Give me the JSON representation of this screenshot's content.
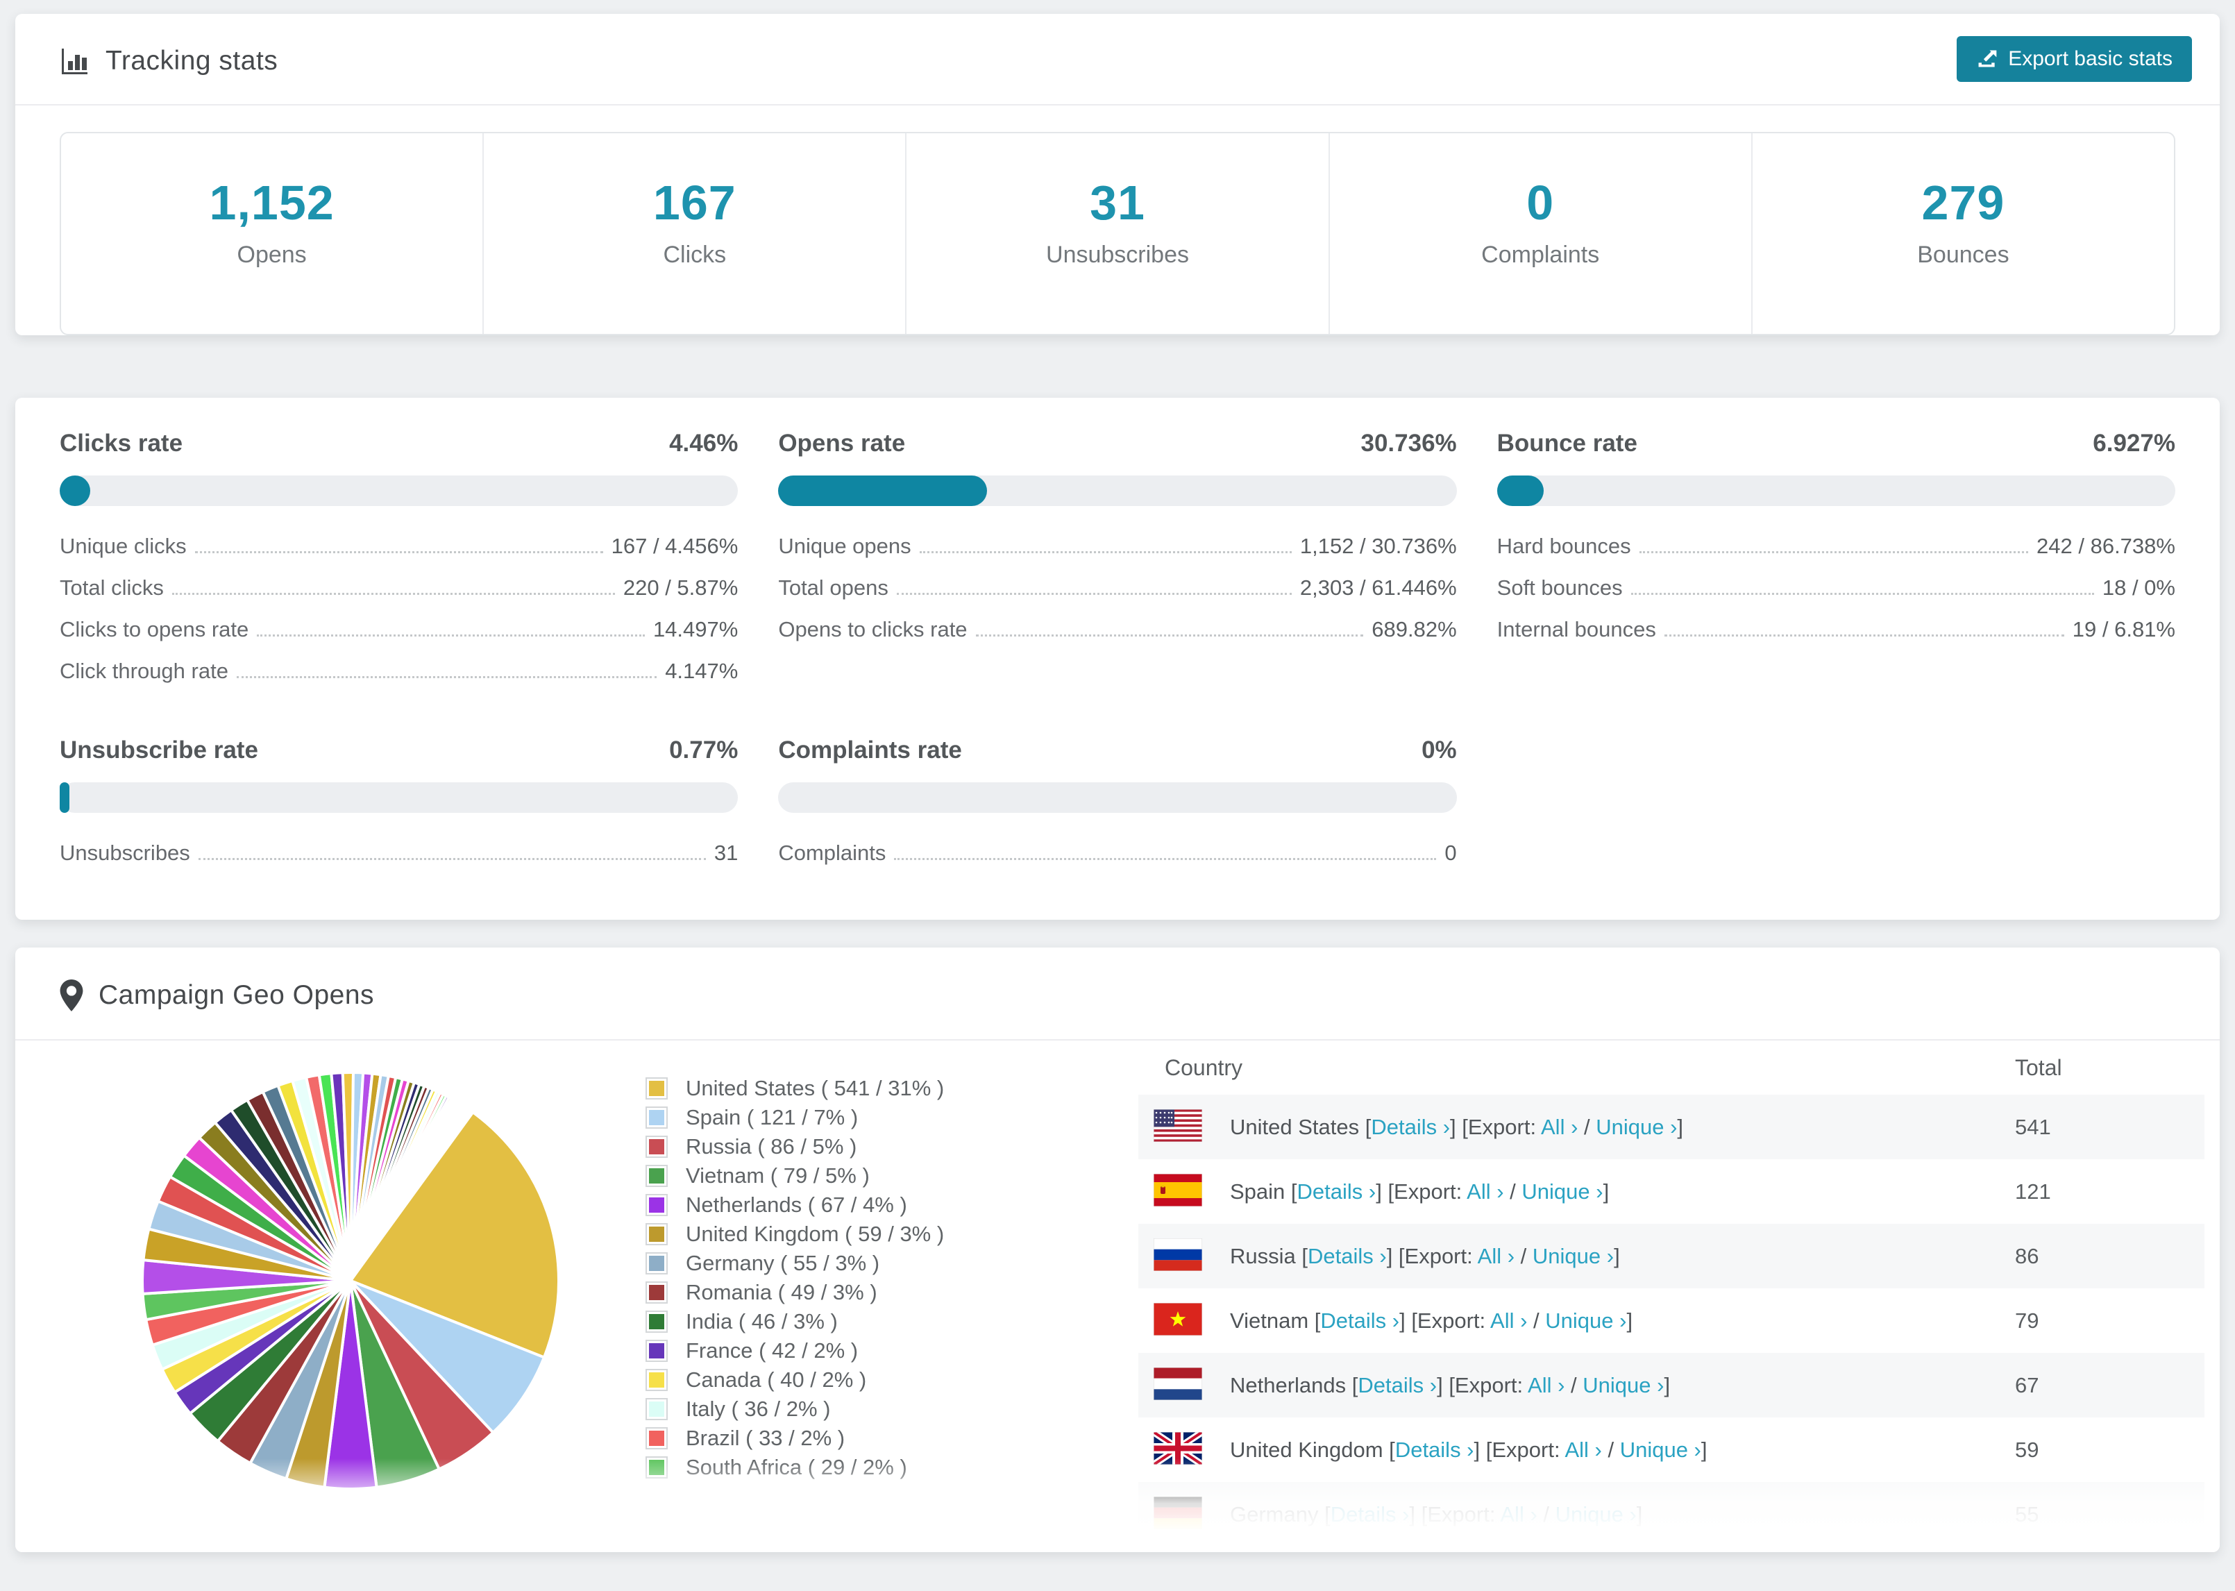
{
  "colors": {
    "accent_teal": "#15829c",
    "bar_fill_teal": "#0f86a2",
    "link_teal": "#2aa2c2",
    "stat_number_teal": "#1e93ae",
    "bar_track": "#eceef1",
    "row_stripe": "#f6f7f8"
  },
  "tracking": {
    "title": "Tracking stats",
    "export_button_label": "Export basic stats",
    "stats": [
      {
        "value": "1,152",
        "label": "Opens"
      },
      {
        "value": "167",
        "label": "Clicks"
      },
      {
        "value": "31",
        "label": "Unsubscribes"
      },
      {
        "value": "0",
        "label": "Complaints"
      },
      {
        "value": "279",
        "label": "Bounces"
      }
    ]
  },
  "rates": [
    {
      "title": "Clicks rate",
      "value": "4.46%",
      "percent": 4.46,
      "rows": [
        {
          "label": "Unique clicks",
          "value": "167 / 4.456%"
        },
        {
          "label": "Total clicks",
          "value": "220 / 5.87%"
        },
        {
          "label": "Clicks to opens rate",
          "value": "14.497%"
        },
        {
          "label": "Click through rate",
          "value": "4.147%"
        }
      ]
    },
    {
      "title": "Opens rate",
      "value": "30.736%",
      "percent": 30.736,
      "rows": [
        {
          "label": "Unique opens",
          "value": "1,152 / 30.736%"
        },
        {
          "label": "Total opens",
          "value": "2,303 / 61.446%"
        },
        {
          "label": "Opens to clicks rate",
          "value": "689.82%"
        }
      ]
    },
    {
      "title": "Bounce rate",
      "value": "6.927%",
      "percent": 6.927,
      "rows": [
        {
          "label": "Hard bounces",
          "value": "242 / 86.738%"
        },
        {
          "label": "Soft bounces",
          "value": "18 / 0%"
        },
        {
          "label": "Internal bounces",
          "value": "19 / 6.81%"
        }
      ]
    },
    {
      "title": "Unsubscribe rate",
      "value": "0.77%",
      "percent": 0.77,
      "rows": [
        {
          "label": "Unsubscribes",
          "value": "31"
        }
      ]
    },
    {
      "title": "Complaints rate",
      "value": "0%",
      "percent": 0,
      "rows": [
        {
          "label": "Complaints",
          "value": "0"
        }
      ]
    }
  ],
  "geo": {
    "title": "Campaign Geo Opens",
    "columns": [
      "Country",
      "Total"
    ],
    "link_labels": {
      "details": "Details",
      "export_prefix": "Export:",
      "all": "All",
      "unique": "Unique"
    },
    "rows": [
      {
        "country": "United States",
        "flag": "us",
        "total": "541"
      },
      {
        "country": "Spain",
        "flag": "es",
        "total": "121"
      },
      {
        "country": "Russia",
        "flag": "ru",
        "total": "86"
      },
      {
        "country": "Vietnam",
        "flag": "vn",
        "total": "79"
      },
      {
        "country": "Netherlands",
        "flag": "nl",
        "total": "67"
      },
      {
        "country": "United Kingdom",
        "flag": "gb",
        "total": "59"
      },
      {
        "country": "Germany",
        "flag": "de",
        "total": "55"
      }
    ]
  },
  "chart_data": {
    "type": "pie",
    "title": "Campaign Geo Opens",
    "legend_position": "right",
    "legend_format": "{label} ( {value} / {percent}% )",
    "slices": [
      {
        "label": "United States",
        "value": 541,
        "percent": 31,
        "color": "#e3bf43"
      },
      {
        "label": "Spain",
        "value": 121,
        "percent": 7,
        "color": "#aed3f2"
      },
      {
        "label": "Russia",
        "value": 86,
        "percent": 5,
        "color": "#c94d54"
      },
      {
        "label": "Vietnam",
        "value": 79,
        "percent": 5,
        "color": "#4aa24e"
      },
      {
        "label": "Netherlands",
        "value": 67,
        "percent": 4,
        "color": "#9b33e6"
      },
      {
        "label": "United Kingdom",
        "value": 59,
        "percent": 3,
        "color": "#bd9a2d"
      },
      {
        "label": "Germany",
        "value": 55,
        "percent": 3,
        "color": "#8eaec7"
      },
      {
        "label": "Romania",
        "value": 49,
        "percent": 3,
        "color": "#9d3a3a"
      },
      {
        "label": "India",
        "value": 46,
        "percent": 3,
        "color": "#2f7c36"
      },
      {
        "label": "France",
        "value": 42,
        "percent": 2,
        "color": "#6636ba"
      },
      {
        "label": "Canada",
        "value": 40,
        "percent": 2,
        "color": "#f6e049"
      },
      {
        "label": "Italy",
        "value": 36,
        "percent": 2,
        "color": "#dbfdf6"
      },
      {
        "label": "Brazil",
        "value": 33,
        "percent": 2,
        "color": "#f1625f"
      },
      {
        "label": "South Africa",
        "value": 29,
        "percent": 2,
        "color": "#5ec55f"
      }
    ],
    "unlabeled_tail": {
      "percent_total": 36,
      "slice_count": 50,
      "decay_ratio": 0.93,
      "palette": [
        "#b44fe8",
        "#c9a227",
        "#a8cbe8",
        "#e05252",
        "#3fae49",
        "#e645d0",
        "#8a7d1f",
        "#2e2b70",
        "#1f4d2a",
        "#7a2e2e",
        "#567a92",
        "#f2e23d",
        "#e8fffb",
        "#f26a6a",
        "#49e455",
        "#6a35bb",
        "#ecc440",
        "#aed3f2"
      ]
    }
  }
}
